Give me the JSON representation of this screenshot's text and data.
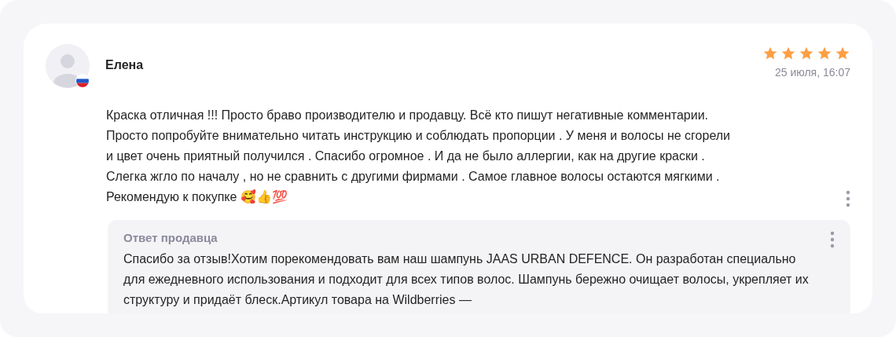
{
  "review": {
    "author": "Елена",
    "stars": 5,
    "date": "25 июля, 16:07",
    "text": "Краска отличная !!! Просто браво производителю и продавцу. Всё кто пишут негативные комментарии. Просто попробуйте внимательно читать инструкцию и соблюдать пропорции . У меня и волосы не сгорели и цвет очень приятный получился . Спасибо огромное . И да не было аллергии, как на другие краски . Слегка жгло по началу , но не сравнить с другими фирмами . Самое главное волосы остаются мягкими . Рекомендую к покупке 🥰👍💯"
  },
  "seller_reply": {
    "title": "Ответ продавца",
    "text": "Спасибо за отзыв!Хотим порекомендовать вам наш шампунь JAAS URBAN DEFENCE. Он разработан специально для ежедневного использования и подходит для всех типов волос. Шампунь бережно очищает волосы, укрепляет их структуру и придаёт блеск.Артикул товара на Wildberries —"
  }
}
